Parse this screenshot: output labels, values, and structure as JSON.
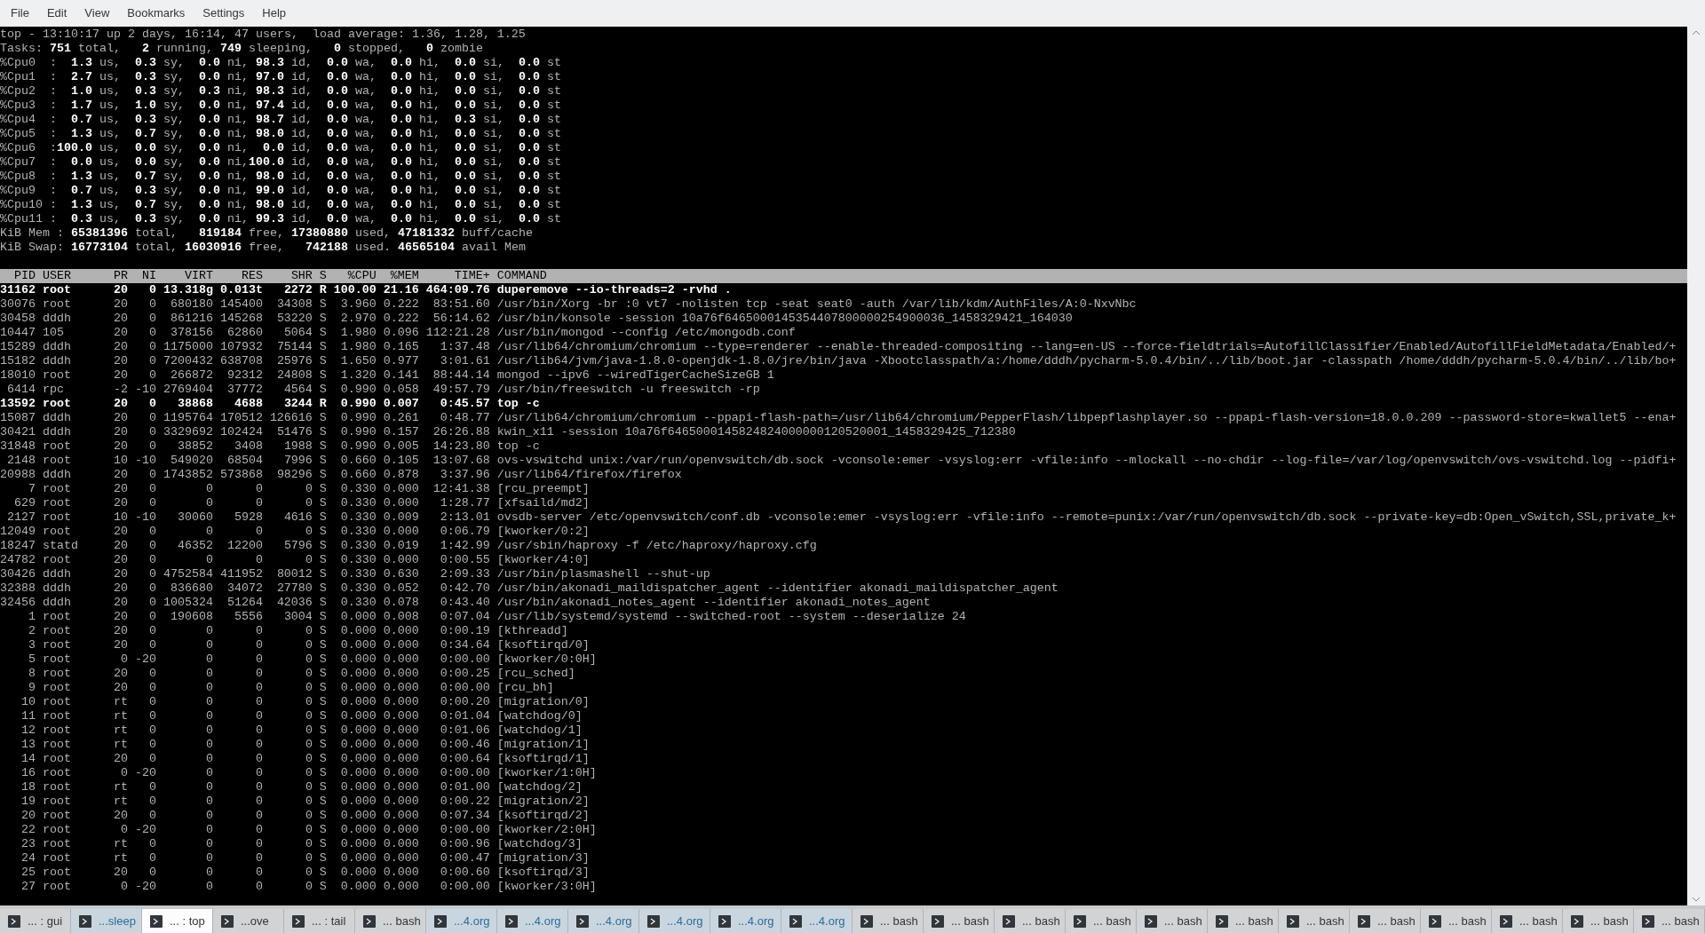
{
  "menu": [
    "File",
    "Edit",
    "View",
    "Bookmarks",
    "Settings",
    "Help"
  ],
  "summary": [
    "top - 13:10:17 up 2 days, 16:14, 47 users,  load average: 1.36, 1.28, 1.25",
    "Tasks: **751** total,   **2** running, **749** sleeping,   **0** stopped,   **0** zombie",
    "%Cpu0  :  **1.3** us,  **0.3** sy,  **0.0** ni, **98.3** id,  **0.0** wa,  **0.0** hi,  **0.0** si,  **0.0** st",
    "%Cpu1  :  **2.7** us,  **0.3** sy,  **0.0** ni, **97.0** id,  **0.0** wa,  **0.0** hi,  **0.0** si,  **0.0** st",
    "%Cpu2  :  **1.0** us,  **0.3** sy,  **0.3** ni, **98.3** id,  **0.0** wa,  **0.0** hi,  **0.0** si,  **0.0** st",
    "%Cpu3  :  **1.7** us,  **1.0** sy,  **0.0** ni, **97.4** id,  **0.0** wa,  **0.0** hi,  **0.0** si,  **0.0** st",
    "%Cpu4  :  **0.7** us,  **0.3** sy,  **0.0** ni, **98.7** id,  **0.0** wa,  **0.0** hi,  **0.3** si,  **0.0** st",
    "%Cpu5  :  **1.3** us,  **0.7** sy,  **0.0** ni, **98.0** id,  **0.0** wa,  **0.0** hi,  **0.0** si,  **0.0** st",
    "%Cpu6  :**100.0** us,  **0.0** sy,  **0.0** ni,  **0.0** id,  **0.0** wa,  **0.0** hi,  **0.0** si,  **0.0** st",
    "%Cpu7  :  **0.0** us,  **0.0** sy,  **0.0** ni,**100.0** id,  **0.0** wa,  **0.0** hi,  **0.0** si,  **0.0** st",
    "%Cpu8  :  **1.3** us,  **0.7** sy,  **0.0** ni, **98.0** id,  **0.0** wa,  **0.0** hi,  **0.0** si,  **0.0** st",
    "%Cpu9  :  **0.7** us,  **0.3** sy,  **0.0** ni, **99.0** id,  **0.0** wa,  **0.0** hi,  **0.0** si,  **0.0** st",
    "%Cpu10 :  **1.3** us,  **0.7** sy,  **0.0** ni, **98.0** id,  **0.0** wa,  **0.0** hi,  **0.0** si,  **0.0** st",
    "%Cpu11 :  **0.3** us,  **0.3** sy,  **0.0** ni, **99.3** id,  **0.0** wa,  **0.0** hi,  **0.0** si,  **0.0** st",
    "KiB Mem : **65381396** total,   **819184** free, **17380880** used, **47181332** buff/cache",
    "KiB Swap: **16773104** total, **16030916** free,   **742188** used. **46565104** avail Mem"
  ],
  "table": {
    "columns": [
      "PID",
      "USER",
      "PR",
      "NI",
      "VIRT",
      "RES",
      "SHR",
      "S",
      "%CPU",
      "%MEM",
      "TIME+",
      "COMMAND"
    ],
    "rows": [
      {
        "cells": [
          "31162",
          "root",
          "20",
          "0",
          "13.318g",
          "0.013t",
          "2272",
          "R",
          "100.00",
          "21.16",
          "464:09.76",
          "duperemove --io-threads=2 -rvhd ."
        ],
        "highlighted": true
      },
      {
        "cells": [
          "30076",
          "root",
          "20",
          "0",
          "680180",
          "145400",
          "34308",
          "S",
          "3.960",
          "0.222",
          "83:51.60",
          "/usr/bin/Xorg -br :0 vt7 -nolisten tcp -seat seat0 -auth /var/lib/kdm/AuthFiles/A:0-NxvNbc"
        ],
        "highlighted": false
      },
      {
        "cells": [
          "30458",
          "dddh",
          "20",
          "0",
          "861216",
          "145268",
          "53220",
          "S",
          "2.970",
          "0.222",
          "56:14.62",
          "/usr/bin/konsole -session 10a76f6465000145354407800000254900036_1458329421_164030"
        ],
        "highlighted": false
      },
      {
        "cells": [
          "10447",
          "105",
          "20",
          "0",
          "378156",
          "62860",
          "5064",
          "S",
          "1.980",
          "0.096",
          "112:21.28",
          "/usr/bin/mongod --config /etc/mongodb.conf"
        ],
        "highlighted": false
      },
      {
        "cells": [
          "15289",
          "dddh",
          "20",
          "0",
          "1175000",
          "107932",
          "75144",
          "S",
          "1.980",
          "0.165",
          "1:37.48",
          "/usr/lib64/chromium/chromium --type=renderer --enable-threaded-compositing --lang=en-US --force-fieldtrials=AutofillClassifier/Enabled/AutofillFieldMetadata/Enabled/+"
        ],
        "highlighted": false
      },
      {
        "cells": [
          "15182",
          "dddh",
          "20",
          "0",
          "7200432",
          "638708",
          "25976",
          "S",
          "1.650",
          "0.977",
          "3:01.61",
          "/usr/lib64/jvm/java-1.8.0-openjdk-1.8.0/jre/bin/java -Xbootclasspath/a:/home/dddh/pycharm-5.0.4/bin/../lib/boot.jar -classpath /home/dddh/pycharm-5.0.4/bin/../lib/bo+"
        ],
        "highlighted": false
      },
      {
        "cells": [
          "18010",
          "root",
          "20",
          "0",
          "266872",
          "92312",
          "24808",
          "S",
          "1.320",
          "0.141",
          "88:44.14",
          "mongod --ipv6 --wiredTigerCacheSizeGB 1"
        ],
        "highlighted": false
      },
      {
        "cells": [
          "6414",
          "rpc",
          "-2",
          "-10",
          "2769404",
          "37772",
          "4564",
          "S",
          "0.990",
          "0.058",
          "49:57.79",
          "/usr/bin/freeswitch -u freeswitch -rp"
        ],
        "highlighted": false
      },
      {
        "cells": [
          "13592",
          "root",
          "20",
          "0",
          "38868",
          "4688",
          "3244",
          "R",
          "0.990",
          "0.007",
          "0:45.57",
          "top -c"
        ],
        "highlighted": true
      },
      {
        "cells": [
          "15087",
          "dddh",
          "20",
          "0",
          "1195764",
          "170512",
          "126616",
          "S",
          "0.990",
          "0.261",
          "0:48.77",
          "/usr/lib64/chromium/chromium --ppapi-flash-path=/usr/lib64/chromium/PepperFlash/libpepflashplayer.so --ppapi-flash-version=18.0.0.209 --password-store=kwallet5 --ena+"
        ],
        "highlighted": false
      },
      {
        "cells": [
          "30421",
          "dddh",
          "20",
          "0",
          "3329692",
          "102424",
          "51476",
          "S",
          "0.990",
          "0.157",
          "26:26.88",
          "kwin_x11 -session 10a76f6465000145824824000000120520001_1458329425_712380"
        ],
        "highlighted": false
      },
      {
        "cells": [
          "31848",
          "root",
          "20",
          "0",
          "38852",
          "3408",
          "1988",
          "S",
          "0.990",
          "0.005",
          "14:23.80",
          "top -c"
        ],
        "highlighted": false
      },
      {
        "cells": [
          "2148",
          "root",
          "10",
          "-10",
          "549020",
          "68504",
          "7996",
          "S",
          "0.660",
          "0.105",
          "13:07.68",
          "ovs-vswitchd unix:/var/run/openvswitch/db.sock -vconsole:emer -vsyslog:err -vfile:info --mlockall --no-chdir --log-file=/var/log/openvswitch/ovs-vswitchd.log --pidfi+"
        ],
        "highlighted": false
      },
      {
        "cells": [
          "20988",
          "dddh",
          "20",
          "0",
          "1743852",
          "573868",
          "98296",
          "S",
          "0.660",
          "0.878",
          "3:37.96",
          "/usr/lib64/firefox/firefox"
        ],
        "highlighted": false
      },
      {
        "cells": [
          "7",
          "root",
          "20",
          "0",
          "0",
          "0",
          "0",
          "S",
          "0.330",
          "0.000",
          "12:41.38",
          "[rcu_preempt]"
        ],
        "highlighted": false
      },
      {
        "cells": [
          "629",
          "root",
          "20",
          "0",
          "0",
          "0",
          "0",
          "S",
          "0.330",
          "0.000",
          "1:28.77",
          "[xfsaild/md2]"
        ],
        "highlighted": false
      },
      {
        "cells": [
          "2127",
          "root",
          "10",
          "-10",
          "30060",
          "5928",
          "4616",
          "S",
          "0.330",
          "0.009",
          "2:13.01",
          "ovsdb-server /etc/openvswitch/conf.db -vconsole:emer -vsyslog:err -vfile:info --remote=punix:/var/run/openvswitch/db.sock --private-key=db:Open_vSwitch,SSL,private_k+"
        ],
        "highlighted": false
      },
      {
        "cells": [
          "12049",
          "root",
          "20",
          "0",
          "0",
          "0",
          "0",
          "S",
          "0.330",
          "0.000",
          "0:06.79",
          "[kworker/0:2]"
        ],
        "highlighted": false
      },
      {
        "cells": [
          "18247",
          "statd",
          "20",
          "0",
          "46352",
          "12200",
          "5796",
          "S",
          "0.330",
          "0.019",
          "1:42.99",
          "/usr/sbin/haproxy -f /etc/haproxy/haproxy.cfg"
        ],
        "highlighted": false
      },
      {
        "cells": [
          "24782",
          "root",
          "20",
          "0",
          "0",
          "0",
          "0",
          "S",
          "0.330",
          "0.000",
          "0:00.55",
          "[kworker/4:0]"
        ],
        "highlighted": false
      },
      {
        "cells": [
          "30426",
          "dddh",
          "20",
          "0",
          "4752584",
          "411952",
          "80012",
          "S",
          "0.330",
          "0.630",
          "2:09.33",
          "/usr/bin/plasmashell --shut-up"
        ],
        "highlighted": false
      },
      {
        "cells": [
          "32388",
          "dddh",
          "20",
          "0",
          "836680",
          "34072",
          "27780",
          "S",
          "0.330",
          "0.052",
          "0:42.70",
          "/usr/bin/akonadi_maildispatcher_agent --identifier akonadi_maildispatcher_agent"
        ],
        "highlighted": false
      },
      {
        "cells": [
          "32456",
          "dddh",
          "20",
          "0",
          "1005324",
          "51264",
          "42036",
          "S",
          "0.330",
          "0.078",
          "0:43.40",
          "/usr/bin/akonadi_notes_agent --identifier akonadi_notes_agent"
        ],
        "highlighted": false
      },
      {
        "cells": [
          "1",
          "root",
          "20",
          "0",
          "190608",
          "5556",
          "3004",
          "S",
          "0.000",
          "0.008",
          "0:07.04",
          "/usr/lib/systemd/systemd --switched-root --system --deserialize 24"
        ],
        "highlighted": false
      },
      {
        "cells": [
          "2",
          "root",
          "20",
          "0",
          "0",
          "0",
          "0",
          "S",
          "0.000",
          "0.000",
          "0:00.19",
          "[kthreadd]"
        ],
        "highlighted": false
      },
      {
        "cells": [
          "3",
          "root",
          "20",
          "0",
          "0",
          "0",
          "0",
          "S",
          "0.000",
          "0.000",
          "0:34.64",
          "[ksoftirqd/0]"
        ],
        "highlighted": false
      },
      {
        "cells": [
          "5",
          "root",
          "0",
          "-20",
          "0",
          "0",
          "0",
          "S",
          "0.000",
          "0.000",
          "0:00.00",
          "[kworker/0:0H]"
        ],
        "highlighted": false
      },
      {
        "cells": [
          "8",
          "root",
          "20",
          "0",
          "0",
          "0",
          "0",
          "S",
          "0.000",
          "0.000",
          "0:00.25",
          "[rcu_sched]"
        ],
        "highlighted": false
      },
      {
        "cells": [
          "9",
          "root",
          "20",
          "0",
          "0",
          "0",
          "0",
          "S",
          "0.000",
          "0.000",
          "0:00.00",
          "[rcu_bh]"
        ],
        "highlighted": false
      },
      {
        "cells": [
          "10",
          "root",
          "rt",
          "0",
          "0",
          "0",
          "0",
          "S",
          "0.000",
          "0.000",
          "0:00.20",
          "[migration/0]"
        ],
        "highlighted": false
      },
      {
        "cells": [
          "11",
          "root",
          "rt",
          "0",
          "0",
          "0",
          "0",
          "S",
          "0.000",
          "0.000",
          "0:01.04",
          "[watchdog/0]"
        ],
        "highlighted": false
      },
      {
        "cells": [
          "12",
          "root",
          "rt",
          "0",
          "0",
          "0",
          "0",
          "S",
          "0.000",
          "0.000",
          "0:01.06",
          "[watchdog/1]"
        ],
        "highlighted": false
      },
      {
        "cells": [
          "13",
          "root",
          "rt",
          "0",
          "0",
          "0",
          "0",
          "S",
          "0.000",
          "0.000",
          "0:00.46",
          "[migration/1]"
        ],
        "highlighted": false
      },
      {
        "cells": [
          "14",
          "root",
          "20",
          "0",
          "0",
          "0",
          "0",
          "S",
          "0.000",
          "0.000",
          "0:00.64",
          "[ksoftirqd/1]"
        ],
        "highlighted": false
      },
      {
        "cells": [
          "16",
          "root",
          "0",
          "-20",
          "0",
          "0",
          "0",
          "S",
          "0.000",
          "0.000",
          "0:00.00",
          "[kworker/1:0H]"
        ],
        "highlighted": false
      },
      {
        "cells": [
          "18",
          "root",
          "rt",
          "0",
          "0",
          "0",
          "0",
          "S",
          "0.000",
          "0.000",
          "0:01.00",
          "[watchdog/2]"
        ],
        "highlighted": false
      },
      {
        "cells": [
          "19",
          "root",
          "rt",
          "0",
          "0",
          "0",
          "0",
          "S",
          "0.000",
          "0.000",
          "0:00.22",
          "[migration/2]"
        ],
        "highlighted": false
      },
      {
        "cells": [
          "20",
          "root",
          "20",
          "0",
          "0",
          "0",
          "0",
          "S",
          "0.000",
          "0.000",
          "0:07.34",
          "[ksoftirqd/2]"
        ],
        "highlighted": false
      },
      {
        "cells": [
          "22",
          "root",
          "0",
          "-20",
          "0",
          "0",
          "0",
          "S",
          "0.000",
          "0.000",
          "0:00.00",
          "[kworker/2:0H]"
        ],
        "highlighted": false
      },
      {
        "cells": [
          "23",
          "root",
          "rt",
          "0",
          "0",
          "0",
          "0",
          "S",
          "0.000",
          "0.000",
          "0:00.96",
          "[watchdog/3]"
        ],
        "highlighted": false
      },
      {
        "cells": [
          "24",
          "root",
          "rt",
          "0",
          "0",
          "0",
          "0",
          "S",
          "0.000",
          "0.000",
          "0:00.47",
          "[migration/3]"
        ],
        "highlighted": false
      },
      {
        "cells": [
          "25",
          "root",
          "20",
          "0",
          "0",
          "0",
          "0",
          "S",
          "0.000",
          "0.000",
          "0:00.60",
          "[ksoftirqd/3]"
        ],
        "highlighted": false
      },
      {
        "cells": [
          "27",
          "root",
          "0",
          "-20",
          "0",
          "0",
          "0",
          "S",
          "0.000",
          "0.000",
          "0:00.00",
          "[kworker/3:0H]"
        ],
        "highlighted": false
      }
    ]
  },
  "tabs": [
    {
      "label": "... : gui",
      "selected": false,
      "activity": false
    },
    {
      "label": "...sleep",
      "selected": false,
      "activity": true
    },
    {
      "label": "... : top",
      "selected": true,
      "activity": false
    },
    {
      "label": "...ove",
      "selected": false,
      "activity": false
    },
    {
      "label": "... : tail",
      "selected": false,
      "activity": false
    },
    {
      "label": "... bash",
      "selected": false,
      "activity": false
    },
    {
      "label": "...4.org",
      "selected": false,
      "activity": true
    },
    {
      "label": "...4.org",
      "selected": false,
      "activity": true
    },
    {
      "label": "...4.org",
      "selected": false,
      "activity": true
    },
    {
      "label": "...4.org",
      "selected": false,
      "activity": true
    },
    {
      "label": "...4.org",
      "selected": false,
      "activity": true
    },
    {
      "label": "...4.org",
      "selected": false,
      "activity": true
    },
    {
      "label": "... bash",
      "selected": false,
      "activity": false
    },
    {
      "label": "... bash",
      "selected": false,
      "activity": false
    },
    {
      "label": "... bash",
      "selected": false,
      "activity": false
    },
    {
      "label": "... bash",
      "selected": false,
      "activity": false
    },
    {
      "label": "... bash",
      "selected": false,
      "activity": false
    },
    {
      "label": "... bash",
      "selected": false,
      "activity": false
    },
    {
      "label": "... bash",
      "selected": false,
      "activity": false
    },
    {
      "label": "... bash",
      "selected": false,
      "activity": false
    },
    {
      "label": "... bash",
      "selected": false,
      "activity": false
    },
    {
      "label": "... bash",
      "selected": false,
      "activity": false
    },
    {
      "label": "... bash",
      "selected": false,
      "activity": false
    },
    {
      "label": "... bash",
      "selected": false,
      "activity": false
    }
  ]
}
